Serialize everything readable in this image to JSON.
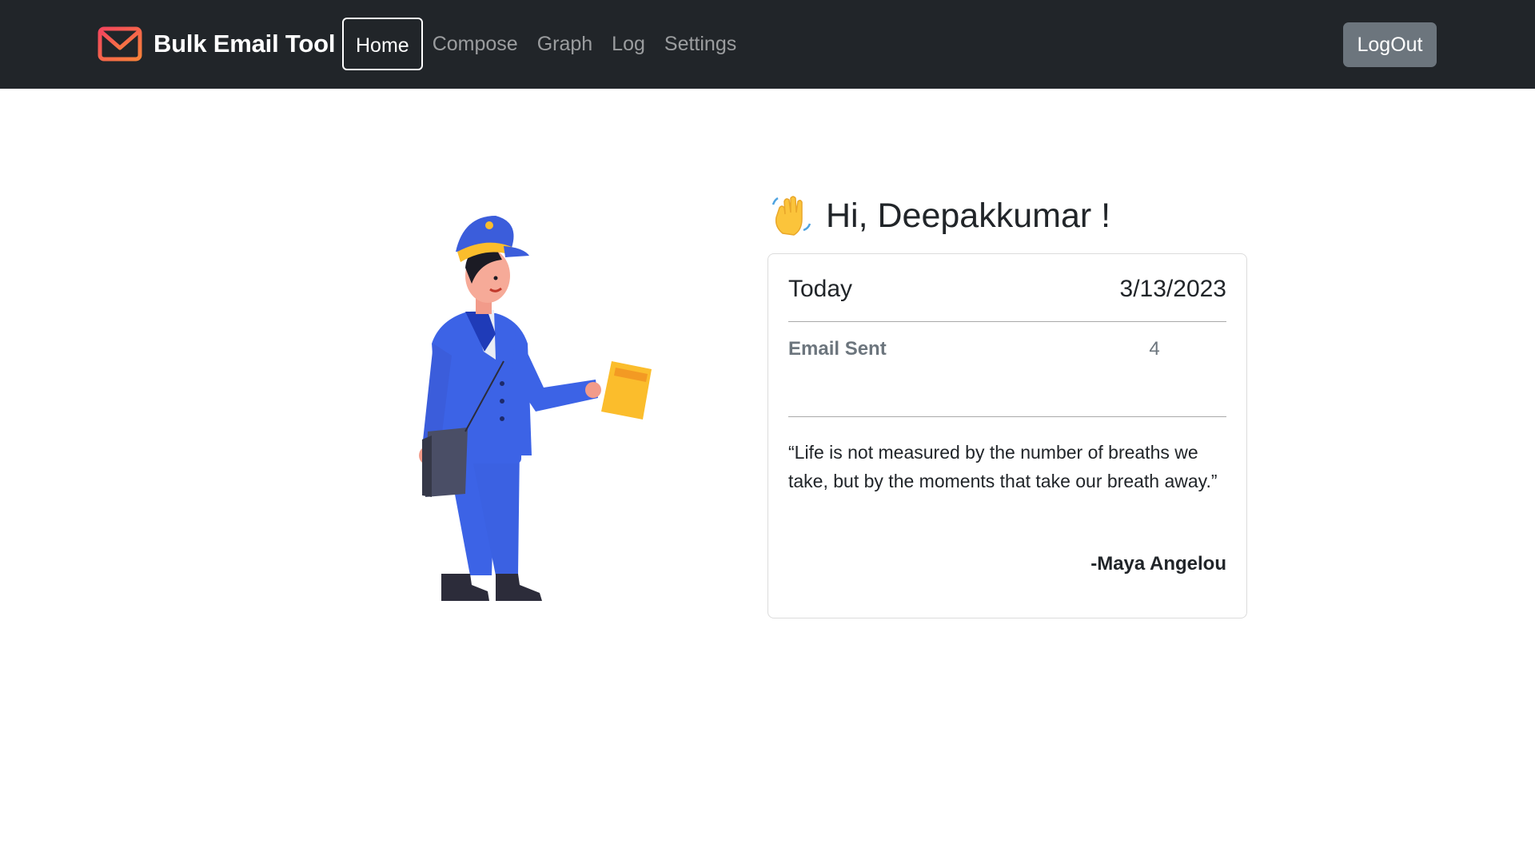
{
  "navbar": {
    "brand": "Bulk Email Tool",
    "links": [
      "Home",
      "Compose",
      "Graph",
      "Log",
      "Settings"
    ],
    "active": "Home",
    "logout_label": "LogOut"
  },
  "greeting": {
    "text": "Hi, Deepakkumar !",
    "icon": "waving-hand-icon"
  },
  "card": {
    "today_label": "Today",
    "today_date": "3/13/2023",
    "sent_label": "Email Sent",
    "sent_value": "4",
    "quote": "“Life is not measured by the number of breaths we take, but by the moments that take our breath away.”",
    "author": "-Maya Angelou"
  },
  "illustration": {
    "icon": "mailman-illustration"
  },
  "colors": {
    "navbar_bg": "#212529",
    "logout_bg": "#6c757d",
    "brand_icon": "#f0573e",
    "uniform": "#3c63e6",
    "envelope": "#fbbd2c"
  }
}
